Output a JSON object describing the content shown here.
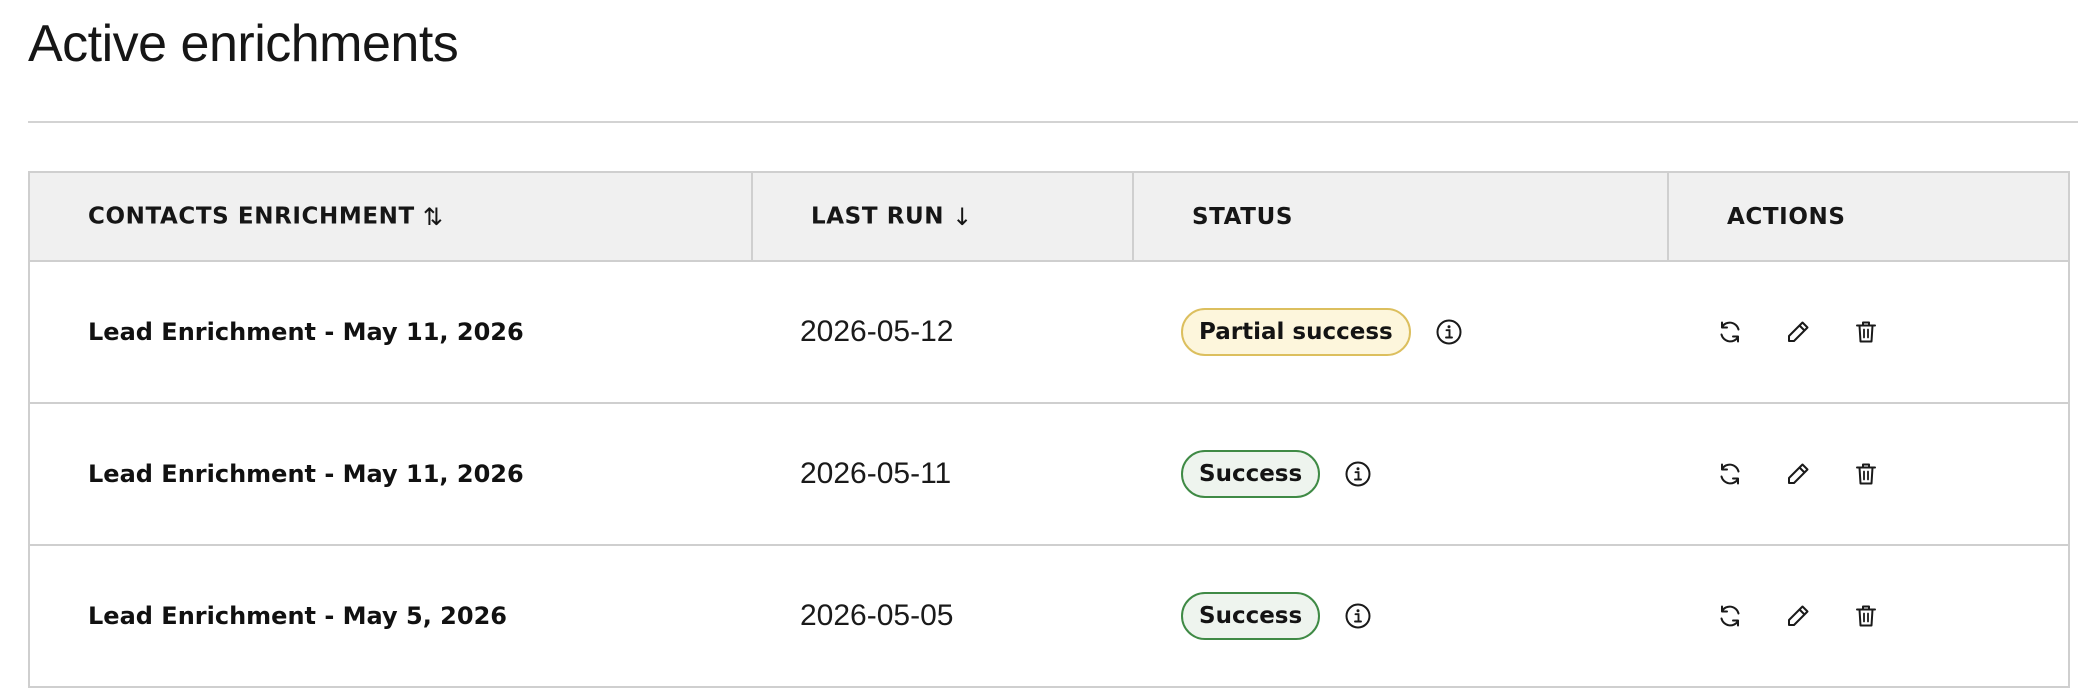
{
  "page": {
    "title": "Active enrichments"
  },
  "table": {
    "columns": [
      {
        "label": "CONTACTS ENRICHMENT",
        "sort_icon": "⇅"
      },
      {
        "label": "LAST RUN",
        "sort_icon": "↓"
      },
      {
        "label": "STATUS"
      },
      {
        "label": "ACTIONS"
      }
    ],
    "rows": [
      {
        "name": "Lead Enrichment - May 11, 2026",
        "last_run": "2026-05-12",
        "status": "Partial success",
        "status_kind": "partial"
      },
      {
        "name": "Lead Enrichment - May 11, 2026",
        "last_run": "2026-05-11",
        "status": "Success",
        "status_kind": "success"
      },
      {
        "name": "Lead Enrichment - May 5, 2026",
        "last_run": "2026-05-05",
        "status": "Success",
        "status_kind": "success"
      }
    ],
    "icons": {
      "info": "info-icon",
      "rerun": "refresh-icon",
      "edit": "pencil-icon",
      "delete": "trash-icon"
    }
  },
  "colors": {
    "partial_bg": "#fdf6dc",
    "partial_border": "#dcbf5e",
    "success_bg": "#eef4ee",
    "success_border": "#3f8a45",
    "header_bg": "#f0f0f0"
  }
}
